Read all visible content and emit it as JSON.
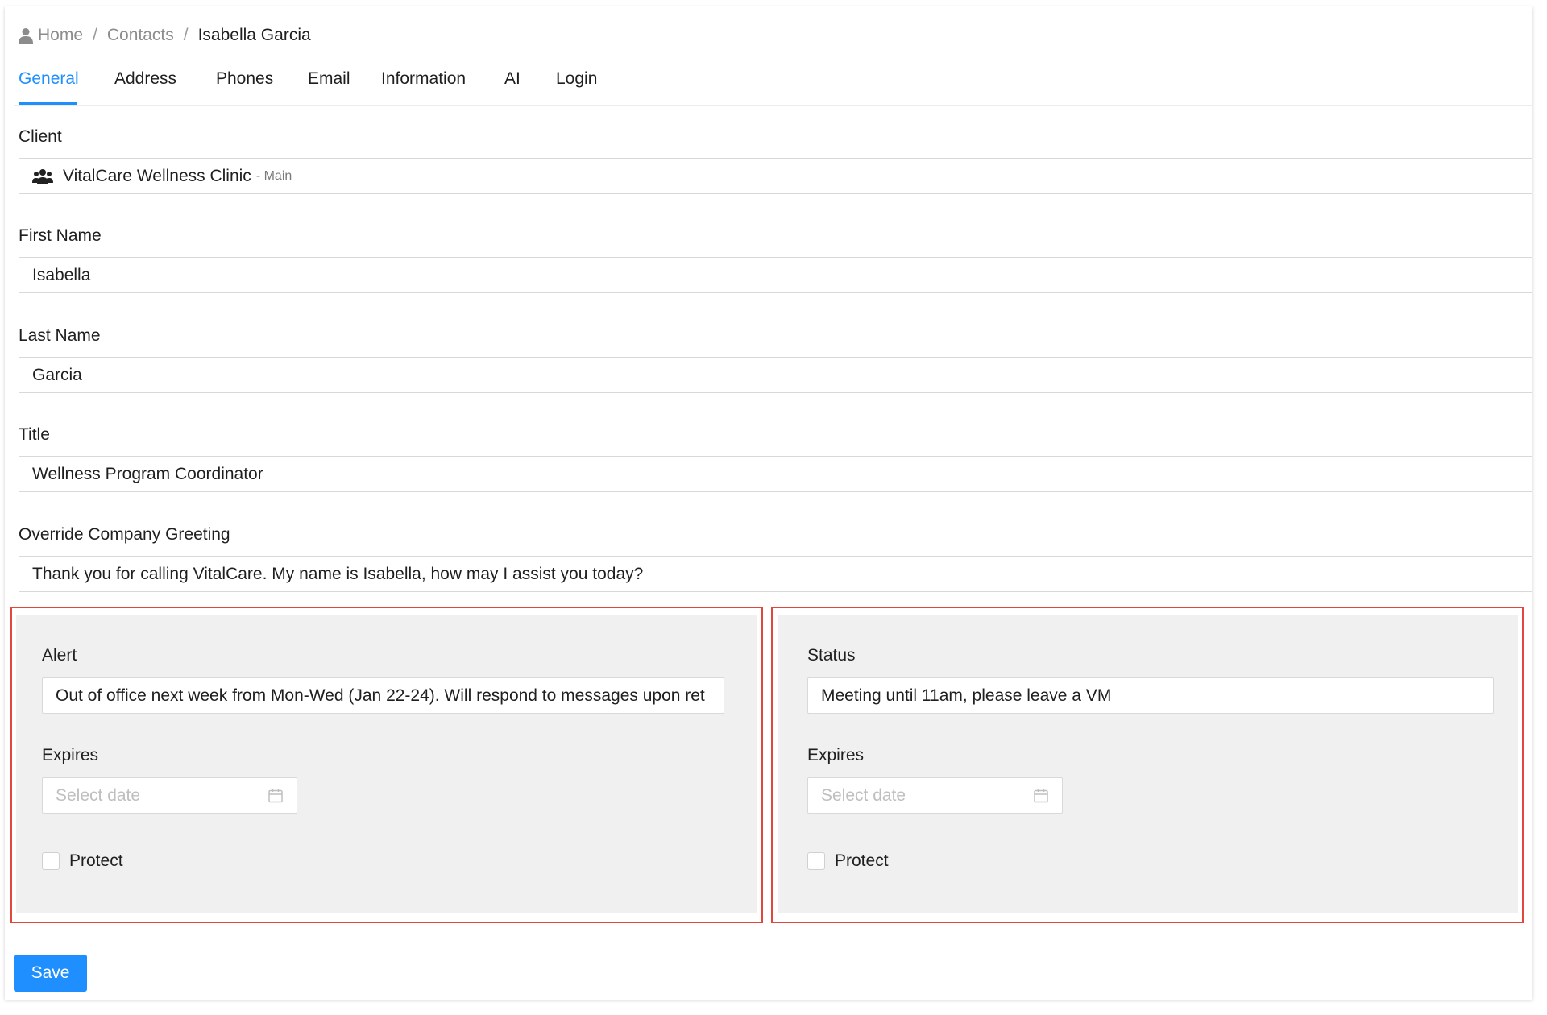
{
  "breadcrumb": {
    "icon": "person-icon",
    "items": [
      "Home",
      "Contacts"
    ],
    "separator": "/",
    "current": "Isabella Garcia"
  },
  "tabs": [
    {
      "label": "General",
      "active": true
    },
    {
      "label": "Address",
      "active": false
    },
    {
      "label": "Phones",
      "active": false
    },
    {
      "label": "Email",
      "active": false
    },
    {
      "label": "Information",
      "active": false
    },
    {
      "label": "AI",
      "active": false
    },
    {
      "label": "Login",
      "active": false
    }
  ],
  "form": {
    "client": {
      "label": "Client",
      "value": "VitalCare Wellness Clinic",
      "suffix": "- Main",
      "icon": "users-icon"
    },
    "first_name": {
      "label": "First Name",
      "value": "Isabella"
    },
    "last_name": {
      "label": "Last Name",
      "value": "Garcia"
    },
    "title": {
      "label": "Title",
      "value": "Wellness Program Coordinator"
    },
    "greeting": {
      "label": "Override Company Greeting",
      "value": "Thank you for calling VitalCare. My name is Isabella, how may I assist you today?"
    }
  },
  "alert_panel": {
    "label": "Alert",
    "value": "Out of office next week from Mon-Wed (Jan 22-24). Will respond to messages upon ret",
    "expires_label": "Expires",
    "date_placeholder": "Select date",
    "protect_label": "Protect",
    "protect_checked": false
  },
  "status_panel": {
    "label": "Status",
    "value": "Meeting until 11am, please leave a VM",
    "expires_label": "Expires",
    "date_placeholder": "Select date",
    "protect_label": "Protect",
    "protect_checked": false
  },
  "save_label": "Save",
  "colors": {
    "accent": "#1f8fff",
    "highlight_outline": "#e2473b",
    "panel_bg": "#f0f0f0"
  }
}
